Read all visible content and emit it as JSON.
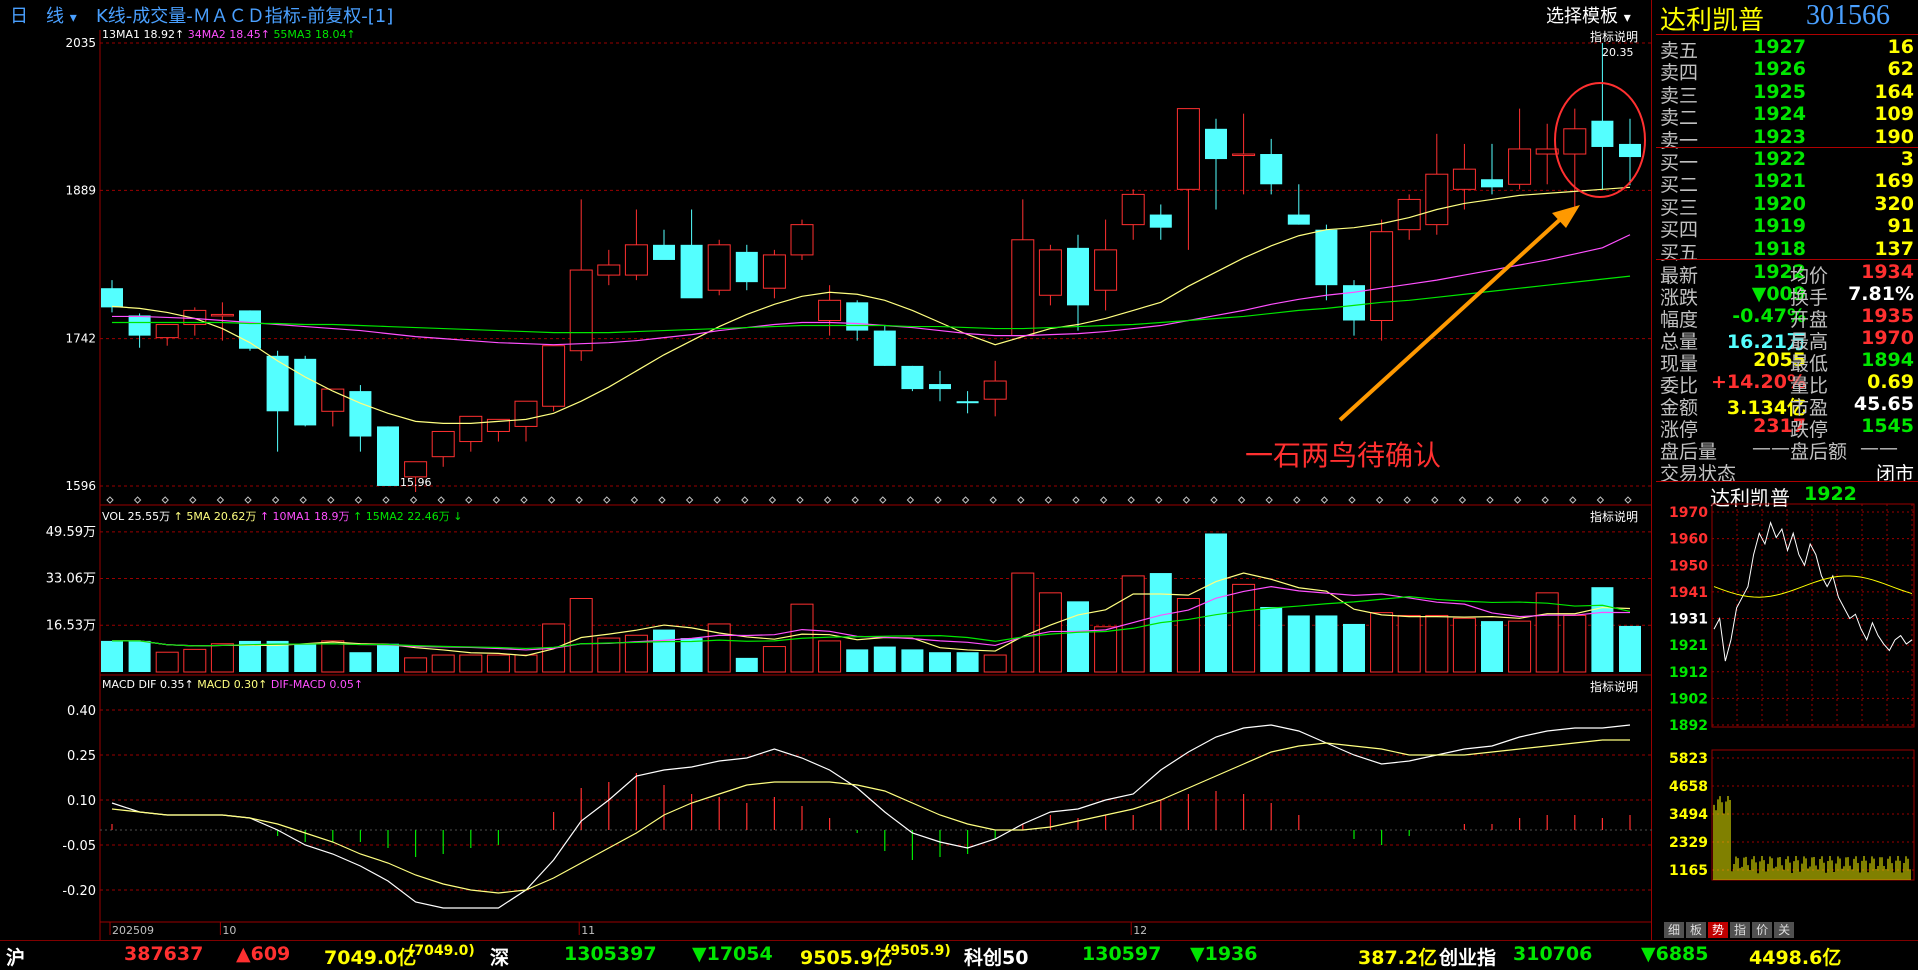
{
  "header": {
    "period": "日　线",
    "period_arrow": "▾",
    "title": "K线-成交量-ＭＡＣＤ指标-前复权-[1]",
    "template_button": "选择模板",
    "template_arrow": "▾"
  },
  "colors": {
    "up": "#ff3030",
    "down": "#54ffff",
    "ma1": "#ffff80",
    "ma2": "#ff50ff",
    "ma3": "#00e600",
    "grid": "#9a0000"
  },
  "main_chart": {
    "ma_legend": [
      {
        "text": "13MA1 18.92↑",
        "color": "#ffffff"
      },
      {
        "text": "34MA2 18.45↑",
        "color": "#ff50ff"
      },
      {
        "text": "55MA3 18.04↑",
        "color": "#00e600"
      }
    ],
    "help": "指标说明",
    "y_labels": [
      "2035",
      "1889",
      "1742",
      "1596"
    ],
    "high_label": "20.35",
    "low_label": "15.96",
    "annotation": "一石两鸟待确认"
  },
  "volume_chart": {
    "legend": [
      {
        "text": "VOL 25.55万",
        "color": "#ffffff"
      },
      {
        "text": "↑ 5MA 20.62万",
        "color": "#ffff80"
      },
      {
        "text": "↑ 10MA1 18.9万",
        "color": "#ff50ff"
      },
      {
        "text": "↑ 15MA2 22.46万 ↓",
        "color": "#00e600"
      }
    ],
    "help": "指标说明",
    "y_labels": [
      "49.59万",
      "33.06万",
      "16.53万"
    ]
  },
  "macd_chart": {
    "legend": [
      {
        "text": "MACD DIF 0.35↑",
        "color": "#ffffff"
      },
      {
        "text": "MACD 0.30↑",
        "color": "#ffff80"
      },
      {
        "text": "DIF-MACD 0.05↑",
        "color": "#ff50ff"
      }
    ],
    "help": "指标说明",
    "y_labels": [
      "0.40",
      "0.25",
      "0.10",
      "-0.05",
      "-0.20"
    ]
  },
  "x_axis": {
    "labels": [
      "202509",
      "10",
      "11",
      "12"
    ]
  },
  "chart_data": {
    "type": "candlestick",
    "candles": [
      {
        "o": 17.92,
        "h": 18.0,
        "l": 17.68,
        "c": 17.73
      },
      {
        "o": 17.65,
        "h": 17.67,
        "l": 17.33,
        "c": 17.45
      },
      {
        "o": 17.43,
        "h": 17.55,
        "l": 17.35,
        "c": 17.56
      },
      {
        "o": 17.56,
        "h": 17.73,
        "l": 17.45,
        "c": 17.7
      },
      {
        "o": 17.66,
        "h": 17.78,
        "l": 17.4,
        "c": 17.66
      },
      {
        "o": 17.7,
        "h": 17.7,
        "l": 17.3,
        "c": 17.32
      },
      {
        "o": 17.25,
        "h": 17.3,
        "l": 16.3,
        "c": 16.7
      },
      {
        "o": 17.22,
        "h": 17.25,
        "l": 16.55,
        "c": 16.56
      },
      {
        "o": 16.7,
        "h": 16.92,
        "l": 16.55,
        "c": 16.92
      },
      {
        "o": 16.9,
        "h": 16.96,
        "l": 16.3,
        "c": 16.45
      },
      {
        "o": 16.55,
        "h": 16.55,
        "l": 15.96,
        "c": 15.96
      },
      {
        "o": 16.05,
        "h": 16.2,
        "l": 15.9,
        "c": 16.2
      },
      {
        "o": 16.25,
        "h": 16.45,
        "l": 16.15,
        "c": 16.5
      },
      {
        "o": 16.4,
        "h": 16.6,
        "l": 16.3,
        "c": 16.65
      },
      {
        "o": 16.5,
        "h": 16.62,
        "l": 16.4,
        "c": 16.62
      },
      {
        "o": 16.55,
        "h": 16.8,
        "l": 16.4,
        "c": 16.8
      },
      {
        "o": 16.75,
        "h": 17.15,
        "l": 16.7,
        "c": 17.35
      },
      {
        "o": 17.3,
        "h": 18.8,
        "l": 17.2,
        "c": 18.1
      },
      {
        "o": 18.05,
        "h": 18.3,
        "l": 17.95,
        "c": 18.15
      },
      {
        "o": 18.05,
        "h": 18.7,
        "l": 18.0,
        "c": 18.35
      },
      {
        "o": 18.35,
        "h": 18.5,
        "l": 18.3,
        "c": 18.2
      },
      {
        "o": 18.35,
        "h": 18.7,
        "l": 18.3,
        "c": 17.82
      },
      {
        "o": 17.9,
        "h": 18.4,
        "l": 17.85,
        "c": 18.35
      },
      {
        "o": 18.28,
        "h": 18.35,
        "l": 17.9,
        "c": 17.98
      },
      {
        "o": 17.92,
        "h": 18.3,
        "l": 17.82,
        "c": 18.25
      },
      {
        "o": 18.25,
        "h": 18.6,
        "l": 18.2,
        "c": 18.55
      },
      {
        "o": 17.6,
        "h": 17.95,
        "l": 17.45,
        "c": 17.8
      },
      {
        "o": 17.78,
        "h": 17.8,
        "l": 17.4,
        "c": 17.5
      },
      {
        "o": 17.5,
        "h": 17.55,
        "l": 17.15,
        "c": 17.15
      },
      {
        "o": 17.15,
        "h": 17.15,
        "l": 16.9,
        "c": 16.92
      },
      {
        "o": 16.97,
        "h": 17.1,
        "l": 16.8,
        "c": 16.92
      },
      {
        "o": 16.8,
        "h": 16.9,
        "l": 16.68,
        "c": 16.78
      },
      {
        "o": 16.82,
        "h": 17.2,
        "l": 16.65,
        "c": 17.0
      },
      {
        "o": 17.45,
        "h": 18.8,
        "l": 17.45,
        "c": 18.4
      },
      {
        "o": 17.85,
        "h": 18.35,
        "l": 17.75,
        "c": 18.3
      },
      {
        "o": 18.32,
        "h": 18.45,
        "l": 17.5,
        "c": 17.75
      },
      {
        "o": 17.9,
        "h": 18.6,
        "l": 17.7,
        "c": 18.3
      },
      {
        "o": 18.55,
        "h": 18.9,
        "l": 18.4,
        "c": 18.85
      },
      {
        "o": 18.65,
        "h": 18.75,
        "l": 18.4,
        "c": 18.52
      },
      {
        "o": 18.9,
        "h": 19.7,
        "l": 18.3,
        "c": 19.7
      },
      {
        "o": 19.5,
        "h": 19.6,
        "l": 18.7,
        "c": 19.2
      },
      {
        "o": 19.25,
        "h": 19.65,
        "l": 18.85,
        "c": 19.25
      },
      {
        "o": 19.25,
        "h": 19.4,
        "l": 18.85,
        "c": 18.95
      },
      {
        "o": 18.65,
        "h": 18.95,
        "l": 18.55,
        "c": 18.55
      },
      {
        "o": 18.5,
        "h": 18.55,
        "l": 17.8,
        "c": 17.95
      },
      {
        "o": 17.95,
        "h": 18.0,
        "l": 17.45,
        "c": 17.6
      },
      {
        "o": 17.6,
        "h": 18.6,
        "l": 17.4,
        "c": 18.48
      },
      {
        "o": 18.5,
        "h": 18.85,
        "l": 18.4,
        "c": 18.8
      },
      {
        "o": 18.55,
        "h": 19.45,
        "l": 18.45,
        "c": 19.05
      },
      {
        "o": 18.9,
        "h": 19.35,
        "l": 18.7,
        "c": 19.1
      },
      {
        "o": 19.0,
        "h": 19.35,
        "l": 18.85,
        "c": 18.92
      },
      {
        "o": 18.95,
        "h": 19.7,
        "l": 18.9,
        "c": 19.3
      },
      {
        "o": 19.25,
        "h": 19.55,
        "l": 18.95,
        "c": 19.3
      },
      {
        "o": 19.25,
        "h": 19.7,
        "l": 18.7,
        "c": 19.5
      },
      {
        "o": 19.58,
        "h": 20.35,
        "l": 18.9,
        "c": 19.32
      },
      {
        "o": 19.35,
        "h": 19.6,
        "l": 18.94,
        "c": 19.22
      }
    ],
    "ma1": [
      17.74,
      17.72,
      17.68,
      17.62,
      17.52,
      17.38,
      17.2,
      17.04,
      16.9,
      16.78,
      16.68,
      16.6,
      16.58,
      16.58,
      16.6,
      16.62,
      16.68,
      16.8,
      16.94,
      17.1,
      17.26,
      17.4,
      17.54,
      17.66,
      17.76,
      17.84,
      17.88,
      17.86,
      17.8,
      17.7,
      17.58,
      17.46,
      17.36,
      17.44,
      17.52,
      17.56,
      17.62,
      17.7,
      17.78,
      17.94,
      18.08,
      18.22,
      18.34,
      18.44,
      18.5,
      18.52,
      18.56,
      18.62,
      18.7,
      18.76,
      18.8,
      18.84,
      18.86,
      18.88,
      18.9,
      18.92
    ],
    "ma2": [
      17.64,
      17.64,
      17.63,
      17.62,
      17.6,
      17.58,
      17.56,
      17.54,
      17.52,
      17.5,
      17.47,
      17.44,
      17.42,
      17.4,
      17.38,
      17.37,
      17.36,
      17.37,
      17.38,
      17.4,
      17.43,
      17.46,
      17.5,
      17.53,
      17.56,
      17.58,
      17.58,
      17.57,
      17.55,
      17.53,
      17.5,
      17.47,
      17.45,
      17.45,
      17.46,
      17.47,
      17.49,
      17.52,
      17.55,
      17.6,
      17.65,
      17.7,
      17.76,
      17.81,
      17.85,
      17.88,
      17.92,
      17.96,
      18.0,
      18.05,
      18.1,
      18.15,
      18.2,
      18.26,
      18.32,
      18.45
    ],
    "ma3": [
      17.58,
      17.58,
      17.58,
      17.58,
      17.58,
      17.57,
      17.57,
      17.56,
      17.56,
      17.55,
      17.54,
      17.53,
      17.52,
      17.51,
      17.5,
      17.49,
      17.48,
      17.48,
      17.48,
      17.49,
      17.5,
      17.51,
      17.52,
      17.53,
      17.54,
      17.55,
      17.55,
      17.55,
      17.55,
      17.54,
      17.54,
      17.53,
      17.52,
      17.52,
      17.53,
      17.54,
      17.55,
      17.56,
      17.58,
      17.6,
      17.62,
      17.64,
      17.67,
      17.7,
      17.72,
      17.75,
      17.78,
      17.8,
      17.83,
      17.86,
      17.89,
      17.92,
      17.95,
      17.98,
      18.01,
      18.04
    ],
    "volume": [
      11,
      11,
      7,
      8,
      10,
      11,
      11,
      10,
      11,
      7,
      10,
      5,
      6,
      6,
      6,
      6,
      17,
      26,
      12,
      13,
      15,
      12,
      17,
      5,
      9,
      24,
      11,
      8,
      9,
      8,
      7,
      7,
      6,
      35,
      28,
      25,
      16,
      34,
      35,
      26,
      49,
      31,
      23,
      20,
      20,
      17,
      21,
      20,
      20,
      19,
      18,
      18,
      28,
      20,
      30,
      16.3
    ],
    "dif": [
      0.09,
      0.06,
      0.05,
      0.05,
      0.05,
      0.04,
      0.0,
      -0.05,
      -0.08,
      -0.12,
      -0.17,
      -0.24,
      -0.26,
      -0.26,
      -0.26,
      -0.2,
      -0.1,
      0.03,
      0.1,
      0.18,
      0.2,
      0.21,
      0.23,
      0.24,
      0.27,
      0.24,
      0.2,
      0.14,
      0.06,
      -0.01,
      -0.04,
      -0.06,
      -0.03,
      0.02,
      0.06,
      0.07,
      0.1,
      0.12,
      0.2,
      0.26,
      0.31,
      0.34,
      0.35,
      0.33,
      0.29,
      0.25,
      0.22,
      0.23,
      0.25,
      0.27,
      0.28,
      0.31,
      0.33,
      0.34,
      0.34,
      0.35
    ],
    "dea": [
      0.07,
      0.06,
      0.05,
      0.05,
      0.05,
      0.04,
      0.02,
      -0.01,
      -0.04,
      -0.08,
      -0.11,
      -0.15,
      -0.18,
      -0.2,
      -0.21,
      -0.2,
      -0.16,
      -0.11,
      -0.06,
      -0.01,
      0.05,
      0.09,
      0.12,
      0.15,
      0.16,
      0.16,
      0.16,
      0.15,
      0.13,
      0.09,
      0.05,
      0.02,
      0.0,
      0.0,
      0.01,
      0.03,
      0.05,
      0.07,
      0.1,
      0.14,
      0.18,
      0.22,
      0.26,
      0.28,
      0.29,
      0.28,
      0.27,
      0.25,
      0.25,
      0.25,
      0.26,
      0.27,
      0.28,
      0.29,
      0.3,
      0.3
    ]
  },
  "quote": {
    "stock_name": "达利凯普",
    "stock_code": "301566",
    "sell": [
      {
        "label": "卖五",
        "price": "1927",
        "vol": "16"
      },
      {
        "label": "卖四",
        "price": "1926",
        "vol": "62"
      },
      {
        "label": "卖三",
        "price": "1925",
        "vol": "164"
      },
      {
        "label": "卖二",
        "price": "1924",
        "vol": "109"
      },
      {
        "label": "卖一",
        "price": "1923",
        "vol": "190"
      }
    ],
    "buy": [
      {
        "label": "买一",
        "price": "1922",
        "vol": "3"
      },
      {
        "label": "买二",
        "price": "1921",
        "vol": "169"
      },
      {
        "label": "买三",
        "price": "1920",
        "vol": "320"
      },
      {
        "label": "买四",
        "price": "1919",
        "vol": "91"
      },
      {
        "label": "买五",
        "price": "1918",
        "vol": "137"
      }
    ],
    "stats": [
      {
        "l1": "最新",
        "v1": "1922",
        "c1": "green",
        "l2": "均价",
        "v2": "1934",
        "c2": "red"
      },
      {
        "l1": "涨跌",
        "v1": "▼009",
        "c1": "green",
        "l2": "换手",
        "v2": "7.81%",
        "c2": "white"
      },
      {
        "l1": "幅度",
        "v1": "-0.47%",
        "c1": "green",
        "l2": "开盘",
        "v2": "1935",
        "c2": "red"
      },
      {
        "l1": "总量",
        "v1": "16.21万",
        "c1": "cyan",
        "l2": "最高",
        "v2": "1970",
        "c2": "red"
      },
      {
        "l1": "现量",
        "v1": "2055",
        "c1": "yellow",
        "l2": "最低",
        "v2": "1894",
        "c2": "green"
      },
      {
        "l1": "委比",
        "v1": "+14.20%",
        "c1": "red",
        "l2": "量比",
        "v2": "0.69",
        "c2": "yellow"
      },
      {
        "l1": "金额",
        "v1": "3.134亿",
        "c1": "yellow",
        "l2": "市盈",
        "v2": "45.65",
        "c2": "white"
      },
      {
        "l1": "涨停",
        "v1": "2317",
        "c1": "red",
        "l2": "跌停",
        "v2": "1545",
        "c2": "green"
      }
    ],
    "after_hours_vol_label": "盘后量",
    "after_hours_vol": "——",
    "after_hours_amt_label": "盘后额",
    "after_hours_amt": "——",
    "trade_state_label": "交易状态",
    "trade_state": "闭市"
  },
  "intraday": {
    "title": "达利凯普",
    "price": "1922",
    "price_labels": [
      "1970",
      "1960",
      "1950",
      "1941",
      "1931",
      "1921",
      "1912",
      "1902",
      "1892"
    ],
    "vol_labels": [
      "5823",
      "4658",
      "3494",
      "2329",
      "1165"
    ],
    "tabs": [
      "细",
      "板",
      "势",
      "指",
      "价",
      "关"
    ],
    "active_tab": "势"
  },
  "status_bar": {
    "items": [
      {
        "name": "沪",
        "val": "387637",
        "chg": "▲609",
        "amt": "7049.0亿",
        "amt2": "(7049.0)"
      },
      {
        "name": "深",
        "val": "1305397",
        "chg": "▼17054",
        "amt": "9505.9亿",
        "amt2": "(9505.9)"
      },
      {
        "name": "科创50",
        "val": "130597",
        "chg": "▼1936",
        "amt": "387.2亿",
        "amt2": ""
      },
      {
        "name": "创业指",
        "val": "310706",
        "chg": "▼6885",
        "amt": "4498.6亿",
        "amt2": ""
      }
    ]
  }
}
